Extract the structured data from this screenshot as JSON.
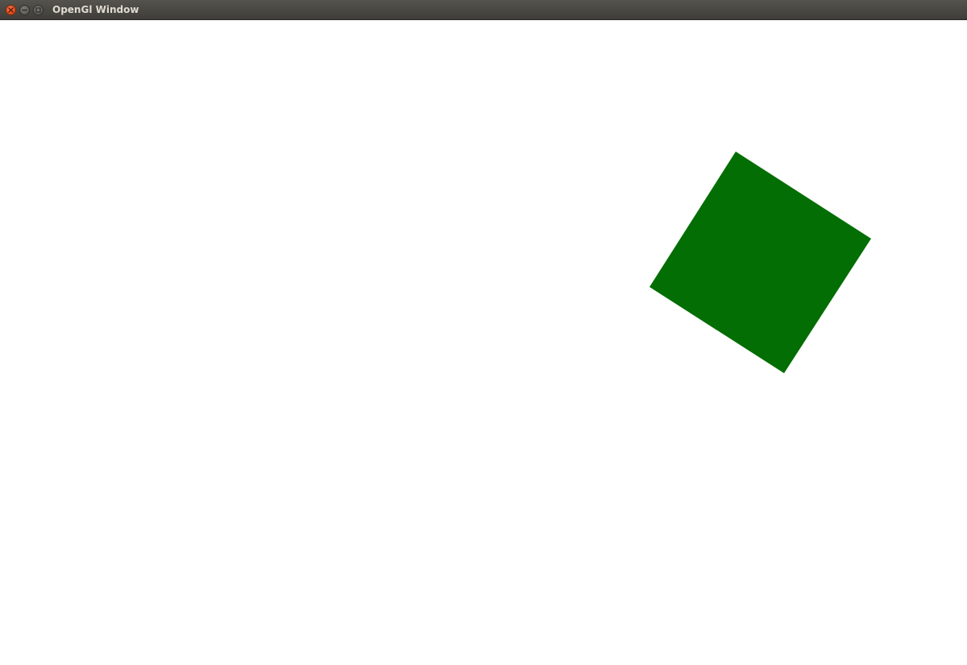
{
  "window": {
    "title": "OpenGl Window"
  },
  "titlebar_buttons": [
    {
      "name": "close",
      "icon": "close-icon",
      "color": "#e2501f"
    },
    {
      "name": "minimize",
      "icon": "minimize-icon",
      "color": "#5f5d58"
    },
    {
      "name": "maximize",
      "icon": "maximize-icon",
      "color": "#5f5d58"
    }
  ],
  "scene": {
    "background_color": "#ffffff",
    "shape": "rotated square",
    "fill_color": "#036e03"
  }
}
